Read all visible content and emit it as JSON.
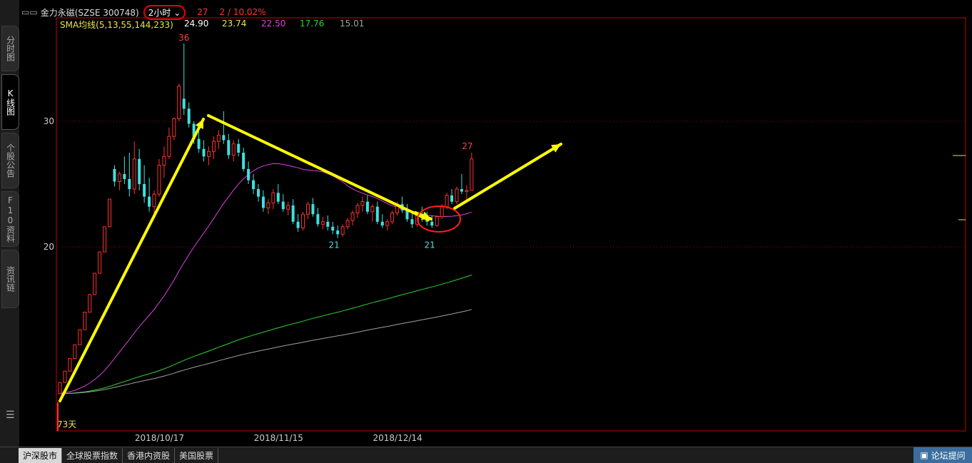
{
  "header": {
    "name": "金力永磁(SZSE 300748)",
    "period": "2小时",
    "price": "27",
    "change": "2 / 10.02%"
  },
  "sma_row": {
    "label": "SMA均线(5,13,55,144,233)",
    "values": [
      "24.90",
      "23.74",
      "22.50",
      "17.76",
      "15.01"
    ],
    "colors": [
      "#ffffff",
      "#e6e64c",
      "#e040e0",
      "#30d030",
      "#a0a0a0"
    ]
  },
  "sidebar": {
    "tabs": [
      "分时图",
      "K线图",
      "个股公告",
      "F10资料",
      "资讯链"
    ]
  },
  "bottom_tabs": [
    "沪深股市",
    "全球股票指数",
    "香港内资股",
    "美国股票"
  ],
  "forum_button": "论坛提问",
  "chart_data": {
    "type": "candlestick",
    "y_ticks": [
      20,
      30
    ],
    "ylim": [
      8,
      38.5
    ],
    "x_labels": [
      {
        "label": "2018/10/17",
        "index": 10
      },
      {
        "label": "2018/11/15",
        "index": 34
      },
      {
        "label": "2018/12/14",
        "index": 58
      }
    ],
    "annotations": {
      "high_label": "36",
      "low_label_1": "21",
      "low_label_2": "21",
      "last_label": "27",
      "days_label": "73天"
    },
    "ohlc": [
      [
        8.3,
        9.2,
        8.3,
        9.2
      ],
      [
        9.2,
        10.1,
        9.2,
        10.1
      ],
      [
        10.1,
        11.1,
        10.1,
        11.1
      ],
      [
        11.1,
        12.2,
        11.1,
        12.2
      ],
      [
        12.2,
        13.4,
        12.2,
        13.4
      ],
      [
        13.4,
        14.8,
        13.4,
        14.8
      ],
      [
        14.8,
        16.2,
        14.8,
        16.2
      ],
      [
        16.2,
        17.9,
        16.2,
        17.9
      ],
      [
        17.9,
        19.6,
        17.9,
        19.6
      ],
      [
        19.6,
        21.6,
        19.6,
        21.6
      ],
      [
        21.6,
        23.8,
        21.6,
        23.8
      ],
      [
        26.2,
        26.5,
        24.8,
        25.2
      ],
      [
        25.2,
        26.0,
        24.5,
        25.8
      ],
      [
        25.8,
        27.2,
        25.0,
        25.4
      ],
      [
        25.4,
        27.5,
        24.0,
        24.6
      ],
      [
        24.6,
        28.4,
        24.2,
        27.0
      ],
      [
        27.0,
        27.8,
        24.5,
        25.0
      ],
      [
        25.0,
        26.5,
        23.5,
        24.0
      ],
      [
        24.0,
        25.5,
        22.8,
        23.2
      ],
      [
        23.2,
        24.5,
        22.5,
        24.2
      ],
      [
        24.2,
        27.0,
        24.0,
        26.5
      ],
      [
        26.5,
        28.0,
        25.5,
        27.2
      ],
      [
        27.2,
        29.5,
        27.0,
        28.8
      ],
      [
        28.8,
        30.3,
        28.5,
        30.2
      ],
      [
        30.2,
        33.0,
        30.0,
        32.8
      ],
      [
        31.8,
        36.2,
        30.5,
        31.0
      ],
      [
        31.0,
        31.5,
        29.5,
        29.8
      ],
      [
        29.8,
        30.0,
        28.2,
        28.6
      ],
      [
        28.6,
        29.2,
        27.5,
        27.8
      ],
      [
        27.8,
        28.5,
        26.8,
        27.2
      ],
      [
        27.2,
        28.0,
        26.5,
        27.6
      ],
      [
        27.6,
        28.8,
        27.0,
        28.4
      ],
      [
        28.4,
        29.3,
        27.8,
        28.9
      ],
      [
        28.9,
        30.8,
        28.2,
        28.5
      ],
      [
        28.5,
        29.0,
        27.0,
        27.3
      ],
      [
        27.3,
        28.5,
        26.8,
        28.2
      ],
      [
        28.2,
        28.6,
        27.2,
        27.5
      ],
      [
        27.5,
        27.9,
        26.0,
        26.2
      ],
      [
        26.2,
        26.8,
        25.0,
        25.3
      ],
      [
        25.3,
        25.8,
        24.2,
        24.6
      ],
      [
        24.6,
        25.0,
        23.6,
        24.0
      ],
      [
        24.0,
        24.5,
        22.8,
        23.1
      ],
      [
        23.1,
        23.8,
        22.6,
        23.5
      ],
      [
        23.5,
        24.6,
        23.0,
        24.3
      ],
      [
        24.3,
        25.0,
        23.4,
        23.6
      ],
      [
        23.6,
        24.2,
        22.8,
        23.0
      ],
      [
        23.0,
        23.6,
        22.5,
        23.3
      ],
      [
        23.3,
        23.8,
        21.8,
        22.0
      ],
      [
        22.0,
        22.6,
        21.2,
        21.5
      ],
      [
        21.5,
        22.8,
        21.3,
        22.6
      ],
      [
        22.6,
        23.6,
        22.2,
        23.4
      ],
      [
        23.4,
        23.9,
        22.4,
        22.6
      ],
      [
        22.6,
        23.1,
        21.6,
        21.8
      ],
      [
        21.8,
        22.4,
        21.4,
        22.0
      ],
      [
        22.0,
        22.5,
        21.3,
        21.6
      ],
      [
        21.6,
        22.0,
        21.0,
        21.3
      ],
      [
        21.3,
        21.7,
        20.7,
        21.0
      ],
      [
        21.0,
        21.8,
        20.8,
        21.6
      ],
      [
        21.6,
        22.3,
        21.4,
        22.1
      ],
      [
        22.1,
        22.9,
        21.7,
        22.7
      ],
      [
        22.7,
        23.5,
        22.3,
        23.3
      ],
      [
        23.3,
        24.0,
        22.8,
        23.6
      ],
      [
        23.6,
        24.1,
        22.6,
        22.8
      ],
      [
        22.8,
        23.4,
        22.0,
        23.2
      ],
      [
        23.2,
        23.6,
        21.8,
        22.0
      ],
      [
        22.0,
        22.6,
        21.5,
        21.7
      ],
      [
        21.7,
        22.2,
        21.3,
        22.0
      ],
      [
        22.0,
        22.9,
        21.8,
        22.7
      ],
      [
        22.7,
        23.6,
        22.5,
        23.4
      ],
      [
        23.4,
        24.0,
        22.7,
        22.9
      ],
      [
        22.9,
        23.4,
        22.0,
        22.2
      ],
      [
        22.2,
        22.8,
        21.5,
        21.8
      ],
      [
        21.8,
        22.7,
        21.6,
        22.5
      ],
      [
        22.5,
        23.2,
        22.0,
        22.3
      ],
      [
        22.3,
        22.8,
        21.7,
        22.0
      ],
      [
        22.0,
        22.5,
        21.5,
        21.7
      ],
      [
        21.7,
        22.5,
        21.6,
        22.4
      ],
      [
        22.4,
        23.4,
        22.2,
        23.2
      ],
      [
        23.2,
        24.3,
        23.0,
        24.1
      ],
      [
        24.1,
        24.6,
        23.4,
        23.6
      ],
      [
        23.6,
        24.8,
        23.4,
        24.6
      ],
      [
        24.6,
        25.8,
        24.2,
        24.4
      ],
      [
        24.4,
        24.9,
        23.6,
        24.5
      ],
      [
        24.5,
        27.5,
        24.5,
        27.0
      ]
    ]
  }
}
